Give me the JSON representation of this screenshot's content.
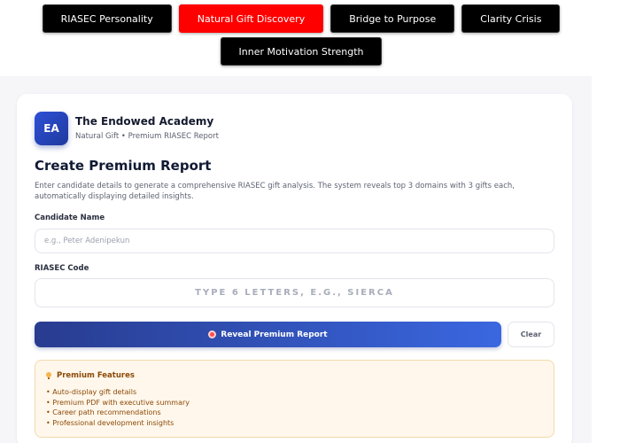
{
  "nav": {
    "tabs": [
      {
        "label": "RIASEC Personality",
        "active": false
      },
      {
        "label": "Natural Gift Discovery",
        "active": true
      },
      {
        "label": "Bridge to Purpose",
        "active": false
      },
      {
        "label": "Clarity Crisis",
        "active": false
      },
      {
        "label": "Inner Motivation Strength",
        "active": false
      }
    ]
  },
  "brand": {
    "logo_text": "EA",
    "name": "The Endowed Academy",
    "subtitle": "Natural Gift • Premium RIASEC Report"
  },
  "main": {
    "title": "Create Premium Report",
    "description": "Enter candidate details to generate a comprehensive RIASEC gift analysis. The system reveals top 3 domains with 3 gifts each, automatically displaying detailed insights."
  },
  "form": {
    "name_label": "Candidate Name",
    "name_value": "",
    "name_placeholder": "e.g., Peter Adenipekun",
    "code_label": "RIASEC Code",
    "code_value": "",
    "code_placeholder": "TYPE 6 LETTERS, E.G., SIERCA",
    "submit_label": "Reveal Premium Report",
    "submit_icon": "target-icon",
    "clear_label": "Clear"
  },
  "features": {
    "icon": "bulb-icon",
    "title": "Premium Features",
    "items": [
      "Auto-display gift details",
      "Premium PDF with executive summary",
      "Career path recommendations",
      "Professional development insights"
    ]
  },
  "colors": {
    "active_tab": "#ff0000",
    "tab_bg": "#000000",
    "primary_start": "#283c8f",
    "primary_end": "#3a67e0",
    "features_bg": "#fff7eb",
    "features_text": "#8b4a07"
  }
}
